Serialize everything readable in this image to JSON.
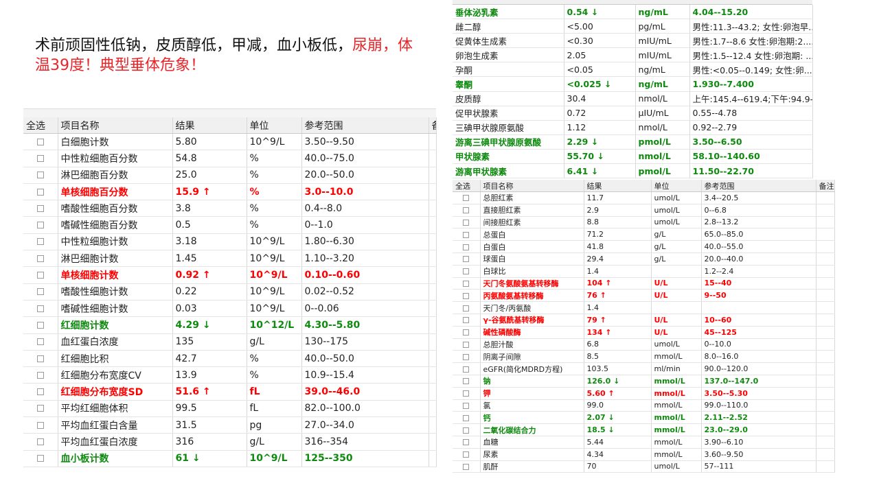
{
  "caption": {
    "black": "术前顽固性低钠，皮质醇低，甲减，血小板低，",
    "red": "尿崩，体温39度！典型垂体危象！"
  },
  "cbc": {
    "headers": [
      "全选",
      "项目名称",
      "结果",
      "单位",
      "参考范围",
      "备"
    ],
    "rows": [
      {
        "name": "白细胞计数",
        "result": "5.80",
        "unit": "10^9/L",
        "range": "3.50--9.50",
        "flag": ""
      },
      {
        "name": "中性粒细胞百分数",
        "result": "54.8",
        "unit": "%",
        "range": "40.0--75.0",
        "flag": ""
      },
      {
        "name": "淋巴细胞百分数",
        "result": "25.0",
        "unit": "%",
        "range": "20.0--50.0",
        "flag": ""
      },
      {
        "name": "单核细胞百分数",
        "result": "15.9 ↑",
        "unit": "%",
        "range": "3.0--10.0",
        "flag": "red"
      },
      {
        "name": "嗜酸性细胞百分数",
        "result": "3.8",
        "unit": "%",
        "range": "0.4--8.0",
        "flag": ""
      },
      {
        "name": "嗜碱性细胞百分数",
        "result": "0.5",
        "unit": "%",
        "range": "0--1.0",
        "flag": ""
      },
      {
        "name": "中性粒细胞计数",
        "result": "3.18",
        "unit": "10^9/L",
        "range": "1.80--6.30",
        "flag": ""
      },
      {
        "name": "淋巴细胞计数",
        "result": "1.45",
        "unit": "10^9/L",
        "range": "1.10--3.20",
        "flag": ""
      },
      {
        "name": "单核细胞计数",
        "result": "0.92 ↑",
        "unit": "10^9/L",
        "range": "0.10--0.60",
        "flag": "red"
      },
      {
        "name": "嗜酸性细胞计数",
        "result": "0.22",
        "unit": "10^9/L",
        "range": "0.02--0.52",
        "flag": ""
      },
      {
        "name": "嗜碱性细胞计数",
        "result": "0.03",
        "unit": "10^9/L",
        "range": "0--0.06",
        "flag": ""
      },
      {
        "name": "红细胞计数",
        "result": "4.29 ↓",
        "unit": "10^12/L",
        "range": "4.30--5.80",
        "flag": "green"
      },
      {
        "name": "血红蛋白浓度",
        "result": "135",
        "unit": "g/L",
        "range": "130--175",
        "flag": ""
      },
      {
        "name": "红细胞比积",
        "result": "42.7",
        "unit": "%",
        "range": "40.0--50.0",
        "flag": ""
      },
      {
        "name": "红细胞分布宽度CV",
        "result": "13.9",
        "unit": "%",
        "range": "10.9--15.4",
        "flag": ""
      },
      {
        "name": "红细胞分布宽度SD",
        "result": "51.6 ↑",
        "unit": "fL",
        "range": "39.0--46.0",
        "flag": "red"
      },
      {
        "name": "平均红细胞体积",
        "result": "99.5",
        "unit": "fL",
        "range": "82.0--100.0",
        "flag": ""
      },
      {
        "name": "平均血红蛋白含量",
        "result": "31.5",
        "unit": "pg",
        "range": "27.0--34.0",
        "flag": ""
      },
      {
        "name": "平均血红蛋白浓度",
        "result": "316",
        "unit": "g/L",
        "range": "316--354",
        "flag": ""
      },
      {
        "name": "血小板计数",
        "result": "61 ↓",
        "unit": "10^9/L",
        "range": "125--350",
        "flag": "green"
      }
    ]
  },
  "endo": {
    "rows": [
      {
        "name": "垂体泌乳素",
        "result": "0.54 ↓",
        "unit": "ng/mL",
        "range": "4.04--15.20",
        "flag": "green"
      },
      {
        "name": "雌二醇",
        "result": "<5.00",
        "unit": "pg/mL",
        "range": "男性:11.3--43.2; 女性:卵泡早...",
        "flag": ""
      },
      {
        "name": "促黄体生成素",
        "result": "<0.30",
        "unit": "mIU/mL",
        "range": "男性:1.7--8.6 女性:卵泡期:2....",
        "flag": ""
      },
      {
        "name": "卵泡生成素",
        "result": "2.05",
        "unit": "mIU/mL",
        "range": "男性:1.5--12.4 女性:卵泡期: ...",
        "flag": ""
      },
      {
        "name": "孕酮",
        "result": "<0.05",
        "unit": "ng/mL",
        "range": "男性:<0.05--0.149; 女性:卵...",
        "flag": ""
      },
      {
        "name": "睾酮",
        "result": "<0.025 ↓",
        "unit": "ng/mL",
        "range": "1.930--7.400",
        "flag": "green"
      },
      {
        "name": "皮质醇",
        "result": "30.4",
        "unit": "nmol/L",
        "range": "上午:145.4--619.4;下午:94.9-...",
        "flag": ""
      },
      {
        "name": "促甲状腺素",
        "result": "0.72",
        "unit": "μIU/mL",
        "range": "0.55--4.78",
        "flag": ""
      },
      {
        "name": "三碘甲状腺原氨酸",
        "result": "1.12",
        "unit": "nmol/L",
        "range": "0.92--2.79",
        "flag": ""
      },
      {
        "name": "游离三碘甲状腺原氨酸",
        "result": "2.29 ↓",
        "unit": "pmol/L",
        "range": "3.50--6.50",
        "flag": "green"
      },
      {
        "name": "甲状腺素",
        "result": "55.70 ↓",
        "unit": "nmol/L",
        "range": "58.10--140.60",
        "flag": "green"
      },
      {
        "name": "游离甲状腺素",
        "result": "6.41 ↓",
        "unit": "pmol/L",
        "range": "11.50--22.70",
        "flag": "green"
      }
    ]
  },
  "chem": {
    "headers": [
      "全选",
      "项目名称",
      "结果",
      "单位",
      "参考范围",
      "备注"
    ],
    "rows": [
      {
        "name": "总胆红素",
        "result": "11.7",
        "unit": "umol/L",
        "range": "3.4--20.5",
        "flag": ""
      },
      {
        "name": "直接胆红素",
        "result": "2.9",
        "unit": "umol/L",
        "range": "0--6.8",
        "flag": ""
      },
      {
        "name": "间接胆红素",
        "result": "8.8",
        "unit": "umol/L",
        "range": "2.8--13.2",
        "flag": ""
      },
      {
        "name": "总蛋白",
        "result": "71.2",
        "unit": "g/L",
        "range": "65.0--85.0",
        "flag": ""
      },
      {
        "name": "白蛋白",
        "result": "41.8",
        "unit": "g/L",
        "range": "40.0--55.0",
        "flag": ""
      },
      {
        "name": "球蛋白",
        "result": "29.4",
        "unit": "g/L",
        "range": "20.0--40.0",
        "flag": ""
      },
      {
        "name": "白球比",
        "result": "1.4",
        "unit": "",
        "range": "1.2--2.4",
        "flag": ""
      },
      {
        "name": "天门冬氨酸氨基转移酶",
        "result": "104 ↑",
        "unit": "U/L",
        "range": "15--40",
        "flag": "red"
      },
      {
        "name": "丙氨酸氨基转移酶",
        "result": "76 ↑",
        "unit": "U/L",
        "range": "9--50",
        "flag": "red"
      },
      {
        "name": "天门冬/丙氨酸",
        "result": "1.4",
        "unit": "",
        "range": "",
        "flag": ""
      },
      {
        "name": "γ-谷氨酰基转移酶",
        "result": "79 ↑",
        "unit": "U/L",
        "range": "10--60",
        "flag": "red"
      },
      {
        "name": "碱性磷酸酶",
        "result": "134 ↑",
        "unit": "U/L",
        "range": "45--125",
        "flag": "red"
      },
      {
        "name": "总胆汁酸",
        "result": "6.8",
        "unit": "umol/L",
        "range": "0--10.0",
        "flag": ""
      },
      {
        "name": "阴离子间隙",
        "result": "8.5",
        "unit": "mmol/L",
        "range": "8.0--16.0",
        "flag": ""
      },
      {
        "name": "eGFR(简化MDRD方程)",
        "result": "103.5",
        "unit": "ml/min",
        "range": "90.0--120.0",
        "flag": ""
      },
      {
        "name": "钠",
        "result": "126.0 ↓",
        "unit": "mmol/L",
        "range": "137.0--147.0",
        "flag": "green"
      },
      {
        "name": "钾",
        "result": "5.60 ↑",
        "unit": "mmol/L",
        "range": "3.50--5.30",
        "flag": "red"
      },
      {
        "name": "氯",
        "result": "99.0",
        "unit": "mmol/L",
        "range": "99.0--110.0",
        "flag": ""
      },
      {
        "name": "钙",
        "result": "2.07 ↓",
        "unit": "mmol/L",
        "range": "2.11--2.52",
        "flag": "green"
      },
      {
        "name": "二氧化碳结合力",
        "result": "18.5 ↓",
        "unit": "mmol/L",
        "range": "23.0--29.0",
        "flag": "green"
      },
      {
        "name": "血糖",
        "result": "5.44",
        "unit": "mmol/L",
        "range": "3.90--6.10",
        "flag": ""
      },
      {
        "name": "尿素",
        "result": "4.34",
        "unit": "mmol/L",
        "range": "3.60--9.50",
        "flag": ""
      },
      {
        "name": "肌酐",
        "result": "70",
        "unit": "umol/L",
        "range": "57--111",
        "flag": ""
      }
    ]
  },
  "colors": {
    "abnormal_high": "#ff0000",
    "abnormal_low": "#0e8a0e",
    "caption_red": "#e8262a"
  }
}
